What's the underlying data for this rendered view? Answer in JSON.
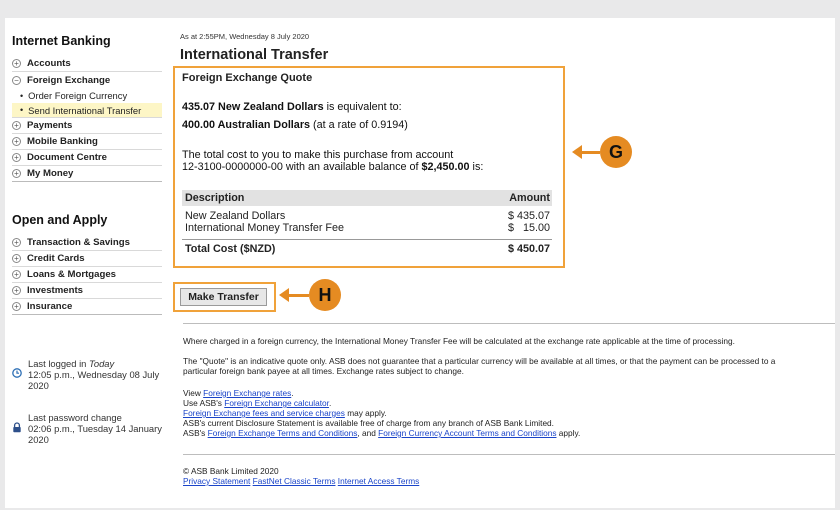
{
  "sidebar": {
    "internet_banking_heading": "Internet Banking",
    "items": [
      {
        "label": "Accounts",
        "toggle": "+"
      },
      {
        "label": "Foreign Exchange",
        "toggle": "−"
      }
    ],
    "sub_items": [
      {
        "label": "Order Foreign Currency",
        "active": false
      },
      {
        "label": "Send International Transfer",
        "active": true
      }
    ],
    "items_after": [
      {
        "label": "Payments",
        "toggle": "+"
      },
      {
        "label": "Mobile Banking",
        "toggle": "+"
      },
      {
        "label": "Document Centre",
        "toggle": "+"
      },
      {
        "label": "My Money",
        "toggle": "+"
      }
    ],
    "open_apply_heading": "Open and Apply",
    "apply_items": [
      {
        "label": "Transaction & Savings",
        "toggle": "+"
      },
      {
        "label": "Credit Cards",
        "toggle": "+"
      },
      {
        "label": "Loans & Mortgages",
        "toggle": "+"
      },
      {
        "label": "Investments",
        "toggle": "+"
      },
      {
        "label": "Insurance",
        "toggle": "+"
      }
    ],
    "last_logged_label": "Last logged in",
    "last_logged_today": "Today",
    "last_logged_value": "12:05 p.m., Wednesday 08 July 2020",
    "last_password_label": "Last password change",
    "last_password_value": "02:06 p.m., Tuesday 14 January 2020"
  },
  "main": {
    "as_at": "As at 2:55PM, Wednesday 8 July 2020",
    "title": "International Transfer",
    "quote": {
      "heading": "Foreign Exchange Quote",
      "nzd_amount": "435.07 New Zealand Dollars",
      "equiv_text": " is equivalent to:",
      "aud_amount": "400.00 Australian Dollars",
      "rate_text": " (at a rate of 0.9194)",
      "cost_line1": "The total cost to you to make this purchase from account",
      "cost_line2_a": "12-3100-0000000-00 with an available balance of ",
      "balance": "$2,450.00",
      "cost_line2_b": " is:",
      "table": {
        "col_description": "Description",
        "col_amount": "Amount",
        "rows": [
          {
            "description": "New Zealand Dollars",
            "amount": "$ 435.07"
          },
          {
            "description": "International Money Transfer Fee",
            "amount": "$   15.00"
          }
        ],
        "total_label": "Total Cost ($NZD)",
        "total_amount": "$ 450.07"
      }
    },
    "make_transfer_label": "Make Transfer",
    "callout_g": "G",
    "callout_h": "H",
    "note1": "Where charged in a foreign currency, the International Money Transfer Fee will be calculated at the exchange rate applicable at the time of processing.",
    "note2": "The \"Quote\" is an indicative quote only. ASB does not guarantee that a particular currency will be available at all times, or that the payment can be processed to a particular foreign bank payee at all times. Exchange rates subject to change.",
    "view_prefix": "View ",
    "fx_rates_link": "Foreign Exchange rates",
    "view_suffix": ".",
    "use_prefix": "Use ASB's ",
    "fx_calc_link": "Foreign Exchange calculator",
    "use_suffix": ".",
    "fees_link": "Foreign Exchange fees and service charges",
    "fees_suffix": " may apply.",
    "disclosure": "ASB's current Disclosure Statement is available free of charge from any branch of ASB Bank Limited.",
    "asb_prefix": "ASB's ",
    "fx_terms_link": "Foreign Exchange Terms and Conditions",
    "and_text": ", and ",
    "fca_terms_link": "Foreign Currency Account Terms and Conditions",
    "apply_suffix": " apply."
  },
  "footer": {
    "copyright": "© ASB Bank Limited 2020",
    "privacy_link": "Privacy Statement",
    "fastnet_link": "FastNet Classic Terms",
    "internet_link": "Internet Access Terms"
  },
  "colors": {
    "highlight_orange": "#f0a23a",
    "callout_orange": "#e58b22",
    "link_blue": "#1a44c9",
    "active_nav_yellow": "#fdf6c6"
  }
}
